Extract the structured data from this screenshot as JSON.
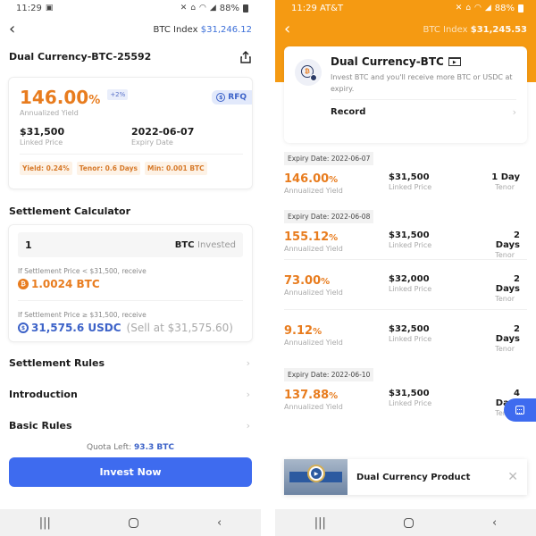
{
  "left": {
    "status": {
      "time": "11:29",
      "battery": "88%"
    },
    "nav": {
      "index_label": "BTC Index",
      "index_value": "$31,246.12"
    },
    "title": "Dual Currency-BTC-25592",
    "yield_card": {
      "yield": "146.00",
      "yield_unit": "%",
      "boost": "+2%",
      "yield_label": "Annualized Yield",
      "rfq_label": "RFQ",
      "linked_price": "$31,500",
      "linked_price_label": "Linked Price",
      "expiry_date": "2022-06-07",
      "expiry_date_label": "Expiry Date",
      "tags": [
        "Yield: 0.24%",
        "Tenor: 0.6 Days",
        "Min: 0.001 BTC"
      ]
    },
    "calculator": {
      "title": "Settlement Calculator",
      "input_value": "1",
      "input_unit": "BTC",
      "input_suffix": "Invested",
      "cond_below": "If Settlement Price  < $31,500, receive",
      "receive_below": "1.0024 BTC",
      "cond_above": "If Settlement Price  ≥ $31,500, receive",
      "receive_above": "31,575.6 USDC",
      "sell_note": "(Sell at $31,575.60)"
    },
    "links": [
      "Settlement Rules",
      "Introduction",
      "Basic Rules"
    ],
    "quota_label": "Quota Left:",
    "quota_value": "93.3 BTC",
    "invest_button": "Invest Now"
  },
  "right": {
    "status": {
      "time": "11:29 AT&T",
      "battery": "88%"
    },
    "nav": {
      "index_label": "BTC Index",
      "index_value": "$31,245.53"
    },
    "product": {
      "name": "Dual Currency-BTC",
      "description": "Invest BTC and you'll receive more BTC or USDC at expiry.",
      "record_label": "Record"
    },
    "labels": {
      "yield": "Annualized Yield",
      "linked": "Linked Price",
      "tenor": "Tenor"
    },
    "groups": [
      {
        "expiry": "Expiry Date: 2022-06-07",
        "rows": [
          {
            "yield": "146.00",
            "price": "$31,500",
            "tenor": "1 Day"
          }
        ]
      },
      {
        "expiry": "Expiry Date: 2022-06-08",
        "rows": [
          {
            "yield": "155.12",
            "price": "$31,500",
            "tenor": "2 Days"
          },
          {
            "yield": "73.00",
            "price": "$32,000",
            "tenor": "2 Days"
          },
          {
            "yield": "9.12",
            "price": "$32,500",
            "tenor": "2 Days"
          }
        ]
      },
      {
        "expiry": "Expiry Date: 2022-06-10",
        "rows": [
          {
            "yield": "137.88",
            "price": "$31,500",
            "tenor": "4 Days"
          }
        ]
      }
    ],
    "video": {
      "title": "Dual Currency Product"
    }
  },
  "colors": {
    "accent_orange": "#e87c1e",
    "header_orange": "#f59a12",
    "primary_blue": "#3e6bef"
  }
}
